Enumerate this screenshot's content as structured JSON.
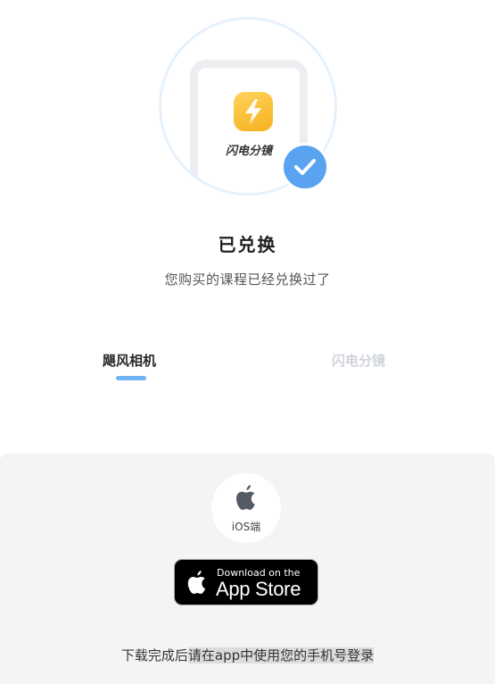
{
  "product": {
    "app_name": "闪电分镜"
  },
  "status": {
    "title": "已兑换",
    "subtitle": "您购买的课程已经兑换过了"
  },
  "tabs": [
    {
      "label": "飓风相机",
      "active": true
    },
    {
      "label": "闪电分镜",
      "active": false
    }
  ],
  "download": {
    "platform_label": "iOS端",
    "appstore_small": "Download on the",
    "appstore_big": "App Store",
    "hint_plain": "下载完成后",
    "hint_highlight": "请在app中使用您的手机号登录"
  },
  "colors": {
    "accent": "#5aa3f0",
    "tab_indicator": "#6fb3f5",
    "app_icon": "#f5b21e"
  }
}
